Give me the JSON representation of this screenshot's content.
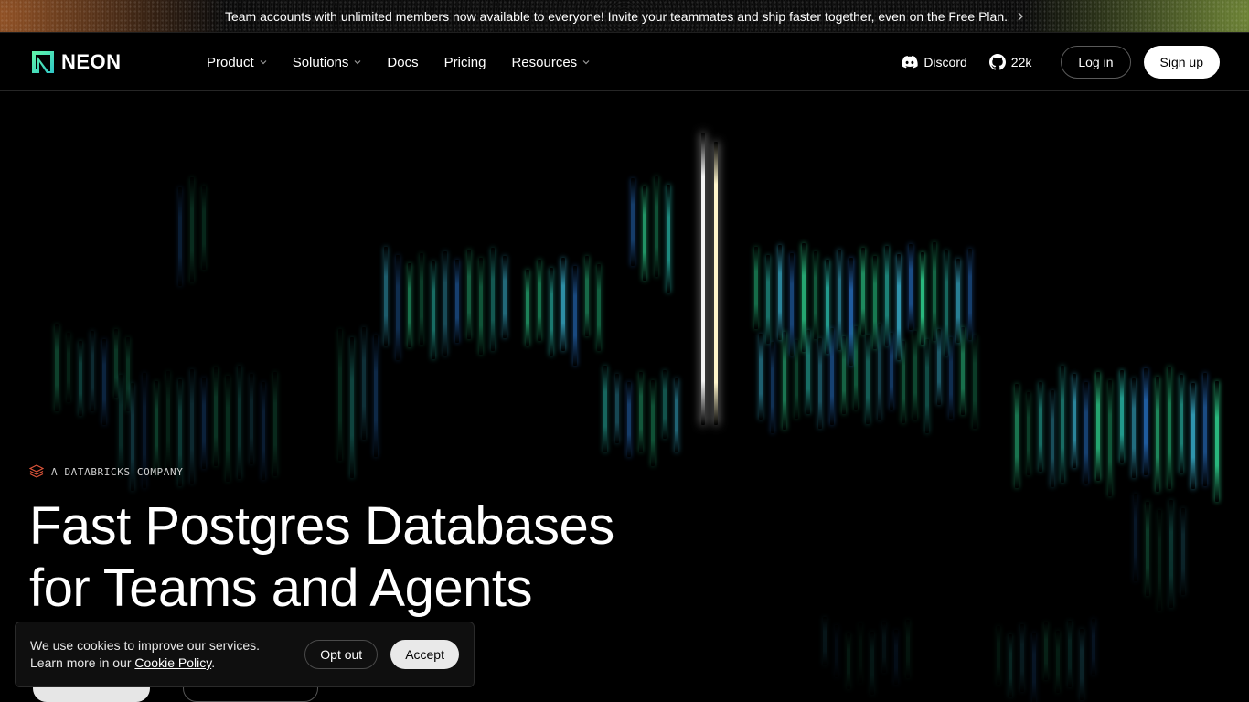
{
  "banner": {
    "text": "Team accounts with unlimited members now available to everyone! Invite your teammates and ship faster together, even on the Free Plan.",
    "chevron_icon": "chevron-right-icon"
  },
  "nav": {
    "logo_text": "NEON",
    "links": [
      {
        "label": "Product",
        "has_dropdown": true
      },
      {
        "label": "Solutions",
        "has_dropdown": true
      },
      {
        "label": "Docs",
        "has_dropdown": false
      },
      {
        "label": "Pricing",
        "has_dropdown": false
      },
      {
        "label": "Resources",
        "has_dropdown": true
      }
    ],
    "discord_label": "Discord",
    "github_label": "22k",
    "login_label": "Log in",
    "signup_label": "Sign up"
  },
  "hero": {
    "eyebrow": "A DATABRICKS COMPANY",
    "headline_line1": "Fast Postgres Databases",
    "headline_line2": "for Teams and Agents"
  },
  "cookie": {
    "line1": "We use cookies to improve our services.",
    "line2_prefix": "Learn more in our",
    "link_label": "Cookie Policy",
    "line2_suffix": ".",
    "optout_label": "Opt out",
    "accept_label": "Accept"
  },
  "colors": {
    "background": "#000000",
    "accent_green": "#34e89e",
    "accent_teal": "#2fd3c2",
    "accent_blue": "#2b7bd6",
    "databricks_red": "#e0563b"
  }
}
